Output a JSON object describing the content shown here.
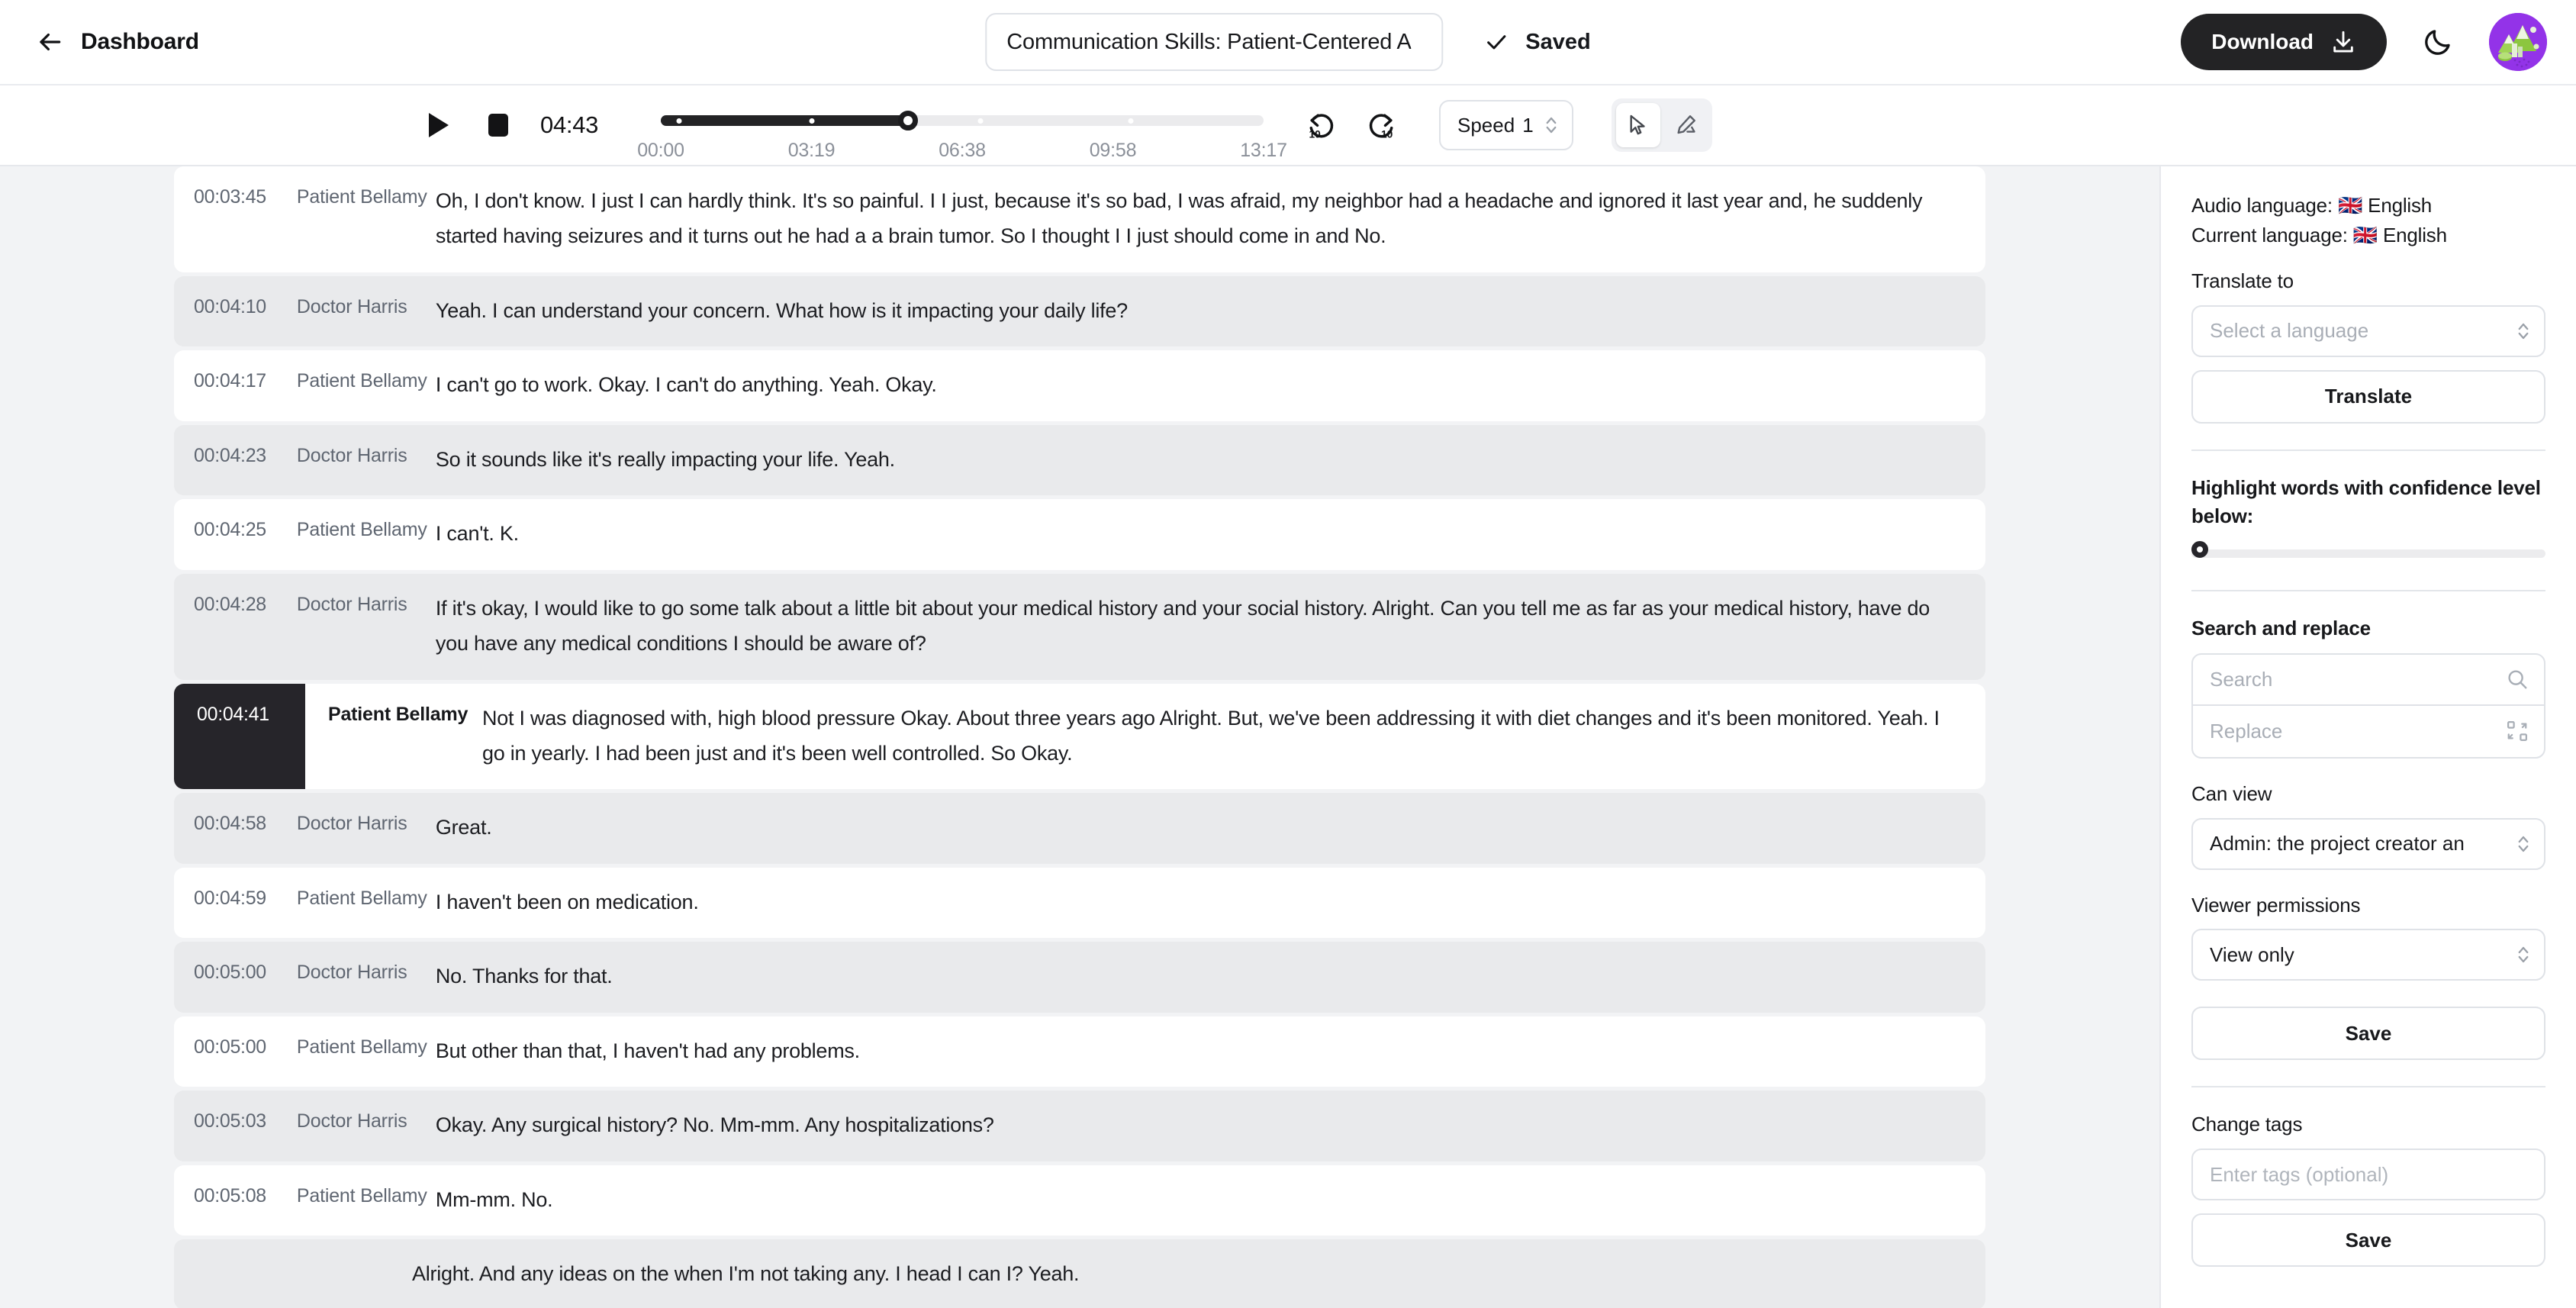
{
  "header": {
    "back_label": "Dashboard",
    "title_value": "Communication Skills: Patient-Centered A",
    "saved_label": "Saved",
    "download_label": "Download"
  },
  "player": {
    "current_time": "04:43",
    "speed_label": "Speed",
    "speed_value": "1",
    "progress_percent": 41,
    "tick_labels": [
      "00:00",
      "03:19",
      "06:38",
      "09:58",
      "13:17"
    ],
    "marker_percent": [
      3,
      25,
      53,
      78
    ]
  },
  "transcript": {
    "rows": [
      {
        "time": "00:03:45",
        "speaker": "Patient Bellamy",
        "text": "Oh, I don't know. I just I can hardly think. It's so painful. I I just, because it's so bad, I was afraid, my neighbor had a headache and ignored it last year and, he suddenly started having seizures and it turns out he had a a brain tumor. So I thought I I just should come in and No.",
        "style": "white"
      },
      {
        "time": "00:04:10",
        "speaker": "Doctor Harris",
        "text": "Yeah. I can understand your concern. What how is it impacting your daily life?",
        "style": "alt"
      },
      {
        "time": "00:04:17",
        "speaker": "Patient Bellamy",
        "text": "I can't go to work. Okay. I can't do anything. Yeah. Okay.",
        "style": "white"
      },
      {
        "time": "00:04:23",
        "speaker": "Doctor Harris",
        "text": "So it sounds like it's really impacting your life. Yeah.",
        "style": "alt"
      },
      {
        "time": "00:04:25",
        "speaker": "Patient Bellamy",
        "text": "I can't. K.",
        "style": "white"
      },
      {
        "time": "00:04:28",
        "speaker": "Doctor Harris",
        "text": "If it's okay, I would like to go some talk about a little bit about your medical history and your social history. Alright. Can you tell me as far as your medical history, have do you have any medical conditions I should be aware of?",
        "style": "alt"
      },
      {
        "time": "00:04:41",
        "speaker": "Patient Bellamy",
        "text": "Not I was diagnosed with, high blood pressure Okay. About three years ago Alright. But, we've been addressing it with diet changes and it's been monitored. Yeah. I go in yearly. I had been just and it's been well controlled. So Okay.",
        "style": "active"
      },
      {
        "time": "00:04:58",
        "speaker": "Doctor Harris",
        "text": "Great.",
        "style": "alt"
      },
      {
        "time": "00:04:59",
        "speaker": "Patient Bellamy",
        "text": "I haven't been on medication.",
        "style": "white"
      },
      {
        "time": "00:05:00",
        "speaker": "Doctor Harris",
        "text": "No. Thanks for that.",
        "style": "alt"
      },
      {
        "time": "00:05:00",
        "speaker": "Patient Bellamy",
        "text": "But other than that, I haven't had any problems.",
        "style": "white"
      },
      {
        "time": "00:05:03",
        "speaker": "Doctor Harris",
        "text": "Okay. Any surgical history? No. Mm-mm. Any hospitalizations?",
        "style": "alt"
      },
      {
        "time": "00:05:08",
        "speaker": "Patient Bellamy",
        "text": "Mm-mm. No.",
        "style": "white"
      },
      {
        "time": "",
        "speaker": "",
        "text": "Alright. And any ideas on the when I'm not taking any. I head I can I? Yeah.",
        "style": "alt"
      }
    ]
  },
  "sidebar": {
    "audio_language_label": "Audio language:",
    "audio_language_value": "🇬🇧 English",
    "current_language_label": "Current language:",
    "current_language_value": "🇬🇧 English",
    "translate_to_label": "Translate to",
    "language_placeholder": "Select a language",
    "translate_button": "Translate",
    "confidence_label": "Highlight words with confidence level below:",
    "confidence_value": 0,
    "search_replace_label": "Search and replace",
    "search_placeholder": "Search",
    "replace_placeholder": "Replace",
    "can_view_label": "Can view",
    "can_view_value": "Admin: the project creator an",
    "viewer_permissions_label": "Viewer permissions",
    "viewer_permissions_value": "View only",
    "save_permissions_button": "Save",
    "change_tags_label": "Change tags",
    "tags_placeholder": "Enter tags (optional)",
    "save_tags_button": "Save"
  }
}
